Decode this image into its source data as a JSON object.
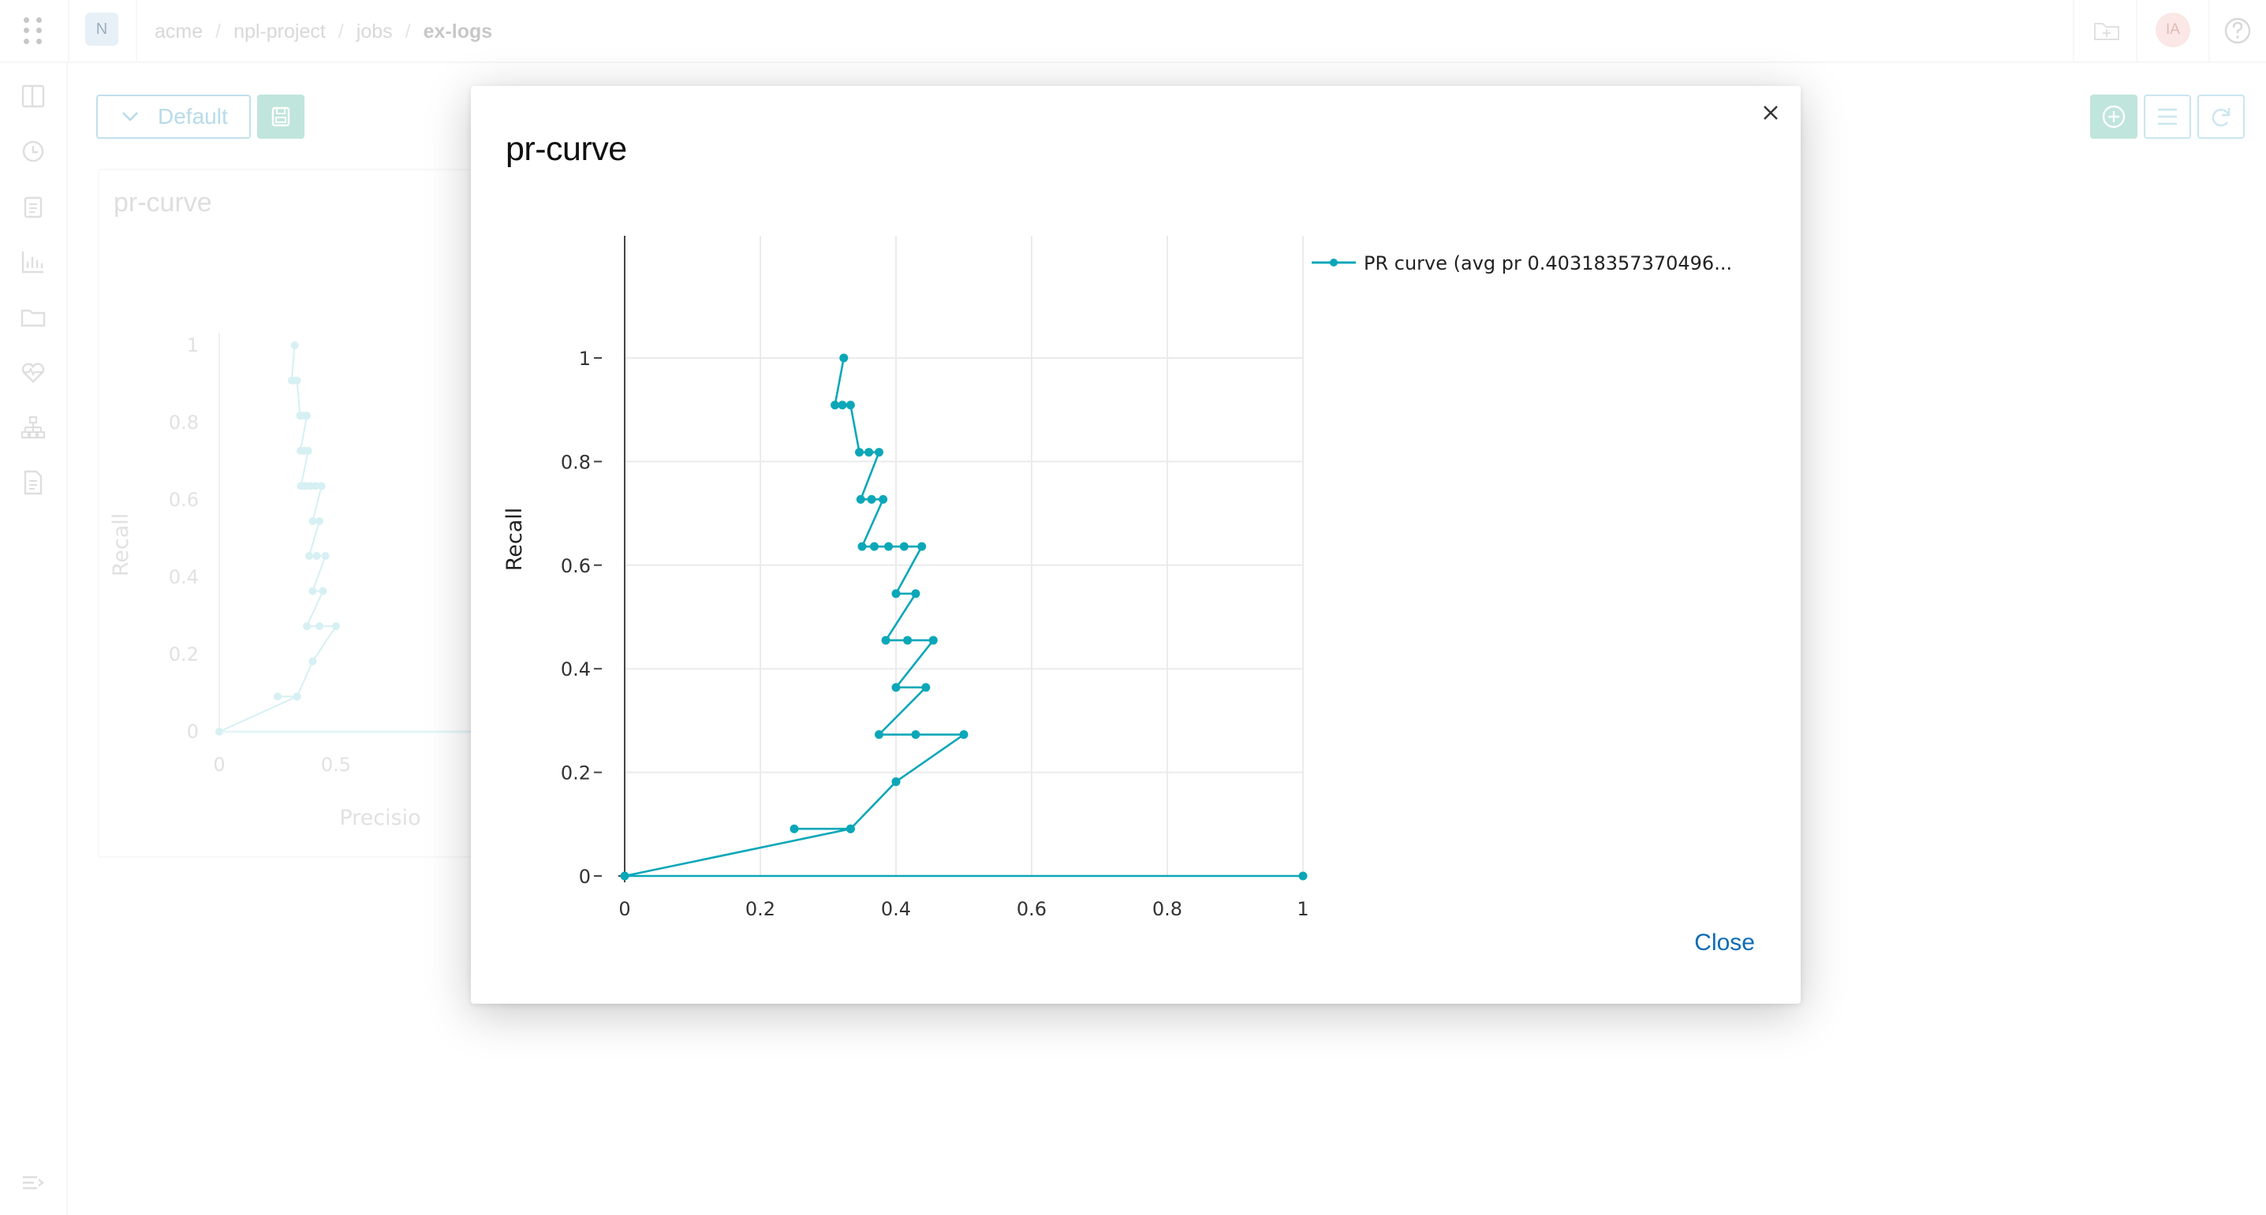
{
  "topbar": {
    "workspace_initial": "N",
    "breadcrumb": [
      "acme",
      "npl-project",
      "jobs",
      "ex-logs"
    ],
    "user_initials": "IA"
  },
  "sidebar": {
    "items": [
      "layout-icon",
      "history-icon",
      "clipboard-icon",
      "chart-icon",
      "folder-icon",
      "heart-monitor-icon",
      "hierarchy-icon",
      "document-icon"
    ],
    "bottom": "expand-icon"
  },
  "toolbar": {
    "view_label": "Default"
  },
  "background_card": {
    "title": "pr-curve",
    "ylabel": "Recall",
    "xlabel": "Precisio",
    "y_ticks": [
      "1",
      "0.8",
      "0.6",
      "0.4",
      "0.2",
      "0"
    ],
    "x_ticks": [
      "0",
      "0.5"
    ]
  },
  "modal": {
    "title": "pr-curve",
    "close_label": "Close"
  },
  "colors": {
    "series": "#0ba7b8",
    "accent": "#0a6bb5",
    "primary_button": "#8ccfbf"
  },
  "chart_data": {
    "type": "line",
    "title": "",
    "xlabel": "",
    "ylabel": "Recall",
    "xlim": [
      0,
      1
    ],
    "ylim": [
      0,
      1.05
    ],
    "x_ticks": [
      0,
      0.2,
      0.4,
      0.6,
      0.8,
      1
    ],
    "x_tick_labels": [
      "0",
      "0.2",
      "0.4",
      "0.6",
      "0.8",
      "1"
    ],
    "y_ticks": [
      0,
      0.2,
      0.4,
      0.6,
      0.8,
      1
    ],
    "y_tick_labels": [
      "0",
      "0.2",
      "0.4",
      "0.6",
      "0.8",
      "1"
    ],
    "grid": true,
    "legend_position": "top-right",
    "series": [
      {
        "name": "PR curve (avg pr 0.40318357370496...",
        "color": "#0ba7b8",
        "x": [
          1.0,
          0.0,
          0.333,
          0.25,
          0.333,
          0.4,
          0.5,
          0.429,
          0.375,
          0.444,
          0.4,
          0.455,
          0.417,
          0.385,
          0.429,
          0.4,
          0.438,
          0.412,
          0.389,
          0.368,
          0.35,
          0.381,
          0.364,
          0.348,
          0.375,
          0.36,
          0.346,
          0.333,
          0.321,
          0.31,
          0.323
        ],
        "y": [
          0.0,
          0.0,
          0.091,
          0.091,
          0.091,
          0.182,
          0.273,
          0.273,
          0.273,
          0.364,
          0.364,
          0.455,
          0.455,
          0.455,
          0.545,
          0.545,
          0.636,
          0.636,
          0.636,
          0.636,
          0.636,
          0.727,
          0.727,
          0.727,
          0.818,
          0.818,
          0.818,
          0.909,
          0.909,
          0.909,
          1.0
        ]
      }
    ]
  }
}
